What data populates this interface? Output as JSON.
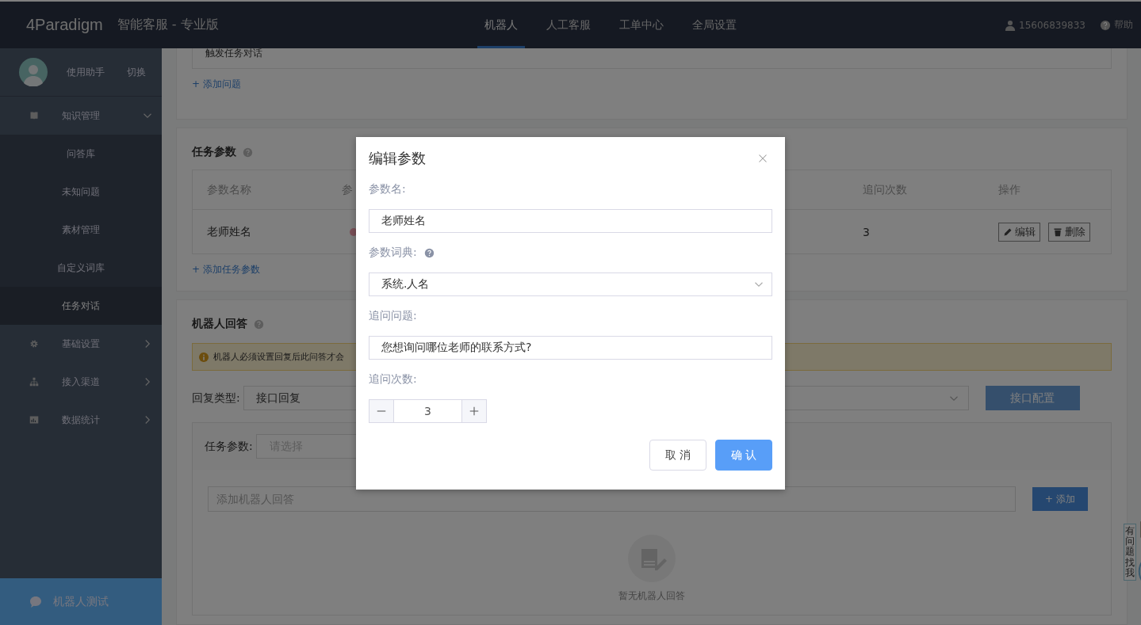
{
  "header": {
    "logo": "4Paradigm",
    "product": "智能客服 - 专业版",
    "nav": [
      {
        "label": "机器人",
        "selected": true
      },
      {
        "label": "人工客服",
        "selected": false
      },
      {
        "label": "工单中心",
        "selected": false
      },
      {
        "label": "全局设置",
        "selected": false
      }
    ],
    "user": "15606839833",
    "help": "帮助"
  },
  "sidebar": {
    "assistant": "使用助手",
    "switch": "切换",
    "menu": [
      {
        "label": "知识管理",
        "kind": "book",
        "expanded": true,
        "children": [
          {
            "label": "问答库",
            "selected": false
          },
          {
            "label": "未知问题",
            "selected": false
          },
          {
            "label": "素材管理",
            "selected": false
          },
          {
            "label": "自定义词库",
            "selected": false
          },
          {
            "label": "任务对话",
            "selected": true
          }
        ]
      },
      {
        "label": "基础设置",
        "kind": "gear",
        "expanded": false
      },
      {
        "label": "接入渠道",
        "kind": "sitemap",
        "expanded": false
      },
      {
        "label": "数据统计",
        "kind": "chart",
        "expanded": false
      }
    ],
    "test_button": "机器人测试"
  },
  "trigger_card": {
    "question": "触发任务对话",
    "add_link": "+ 添加问题"
  },
  "params_card": {
    "title": "任务参数",
    "columns": [
      "参数名称",
      "参",
      "追问次数",
      "操作"
    ],
    "rows": [
      {
        "name": "老师姓名",
        "count": "3",
        "edit": "编辑",
        "delete": "删除"
      }
    ],
    "add_link": "+ 添加任务参数"
  },
  "reply_card": {
    "title": "机器人回答",
    "alert": "机器人必须设置回复后此问答才会",
    "reply_type_label": "回复类型:",
    "reply_type_value": "接口回复",
    "config_button": "接口配置",
    "param_label": "任务参数:",
    "param_placeholder": "请选择",
    "answer_placeholder": "添加机器人回答",
    "add_button": "+ 添加",
    "empty_text": "暂无机器人回答"
  },
  "mascot": {
    "text": "有问题找我"
  },
  "modal": {
    "title": "编辑参数",
    "fields": [
      {
        "kind": "input",
        "label": "参数名:",
        "value": "老师姓名"
      },
      {
        "kind": "select",
        "label": "参数词典:",
        "value": "系统.人名",
        "help": true
      },
      {
        "kind": "input",
        "label": "追问问题:",
        "value": "您想询问哪位老师的联系方式?"
      },
      {
        "kind": "stepper",
        "label": "追问次数:",
        "value": "3"
      }
    ],
    "buttons": [
      {
        "label": "取 消",
        "kind": "default"
      },
      {
        "label": "确 认",
        "kind": "primary"
      }
    ]
  }
}
